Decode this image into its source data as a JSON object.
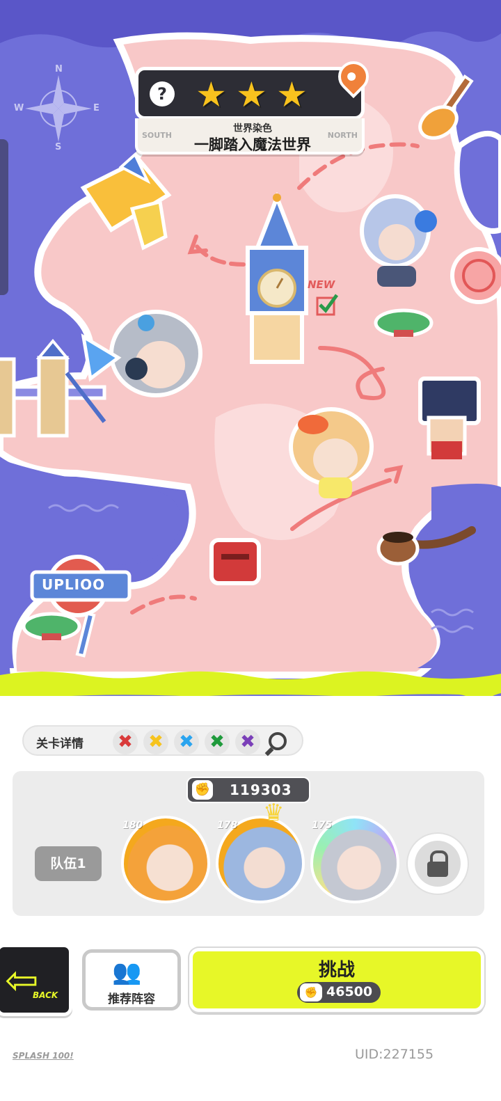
{
  "stage": {
    "stars": 3,
    "subtitle": "世界染色",
    "title": "一脚踏入魔法世界",
    "dir_left": "SOUTH",
    "dir_right": "NORTH",
    "help_label": "?"
  },
  "map": {
    "compass": {
      "n": "N",
      "s": "S",
      "e": "E",
      "w": "W"
    },
    "new_label": "NEW",
    "sign_text": "UPLIOO"
  },
  "details": {
    "label": "关卡详情",
    "color_marks": [
      {
        "color": "#d93a3a",
        "name": "red"
      },
      {
        "color": "#f6c31d",
        "name": "yellow"
      },
      {
        "color": "#2aa4ef",
        "name": "blue"
      },
      {
        "color": "#1f9a3c",
        "name": "green"
      },
      {
        "color": "#7a3fb8",
        "name": "purple"
      }
    ],
    "search_icon": "magnifier-icon"
  },
  "team": {
    "power": "119303",
    "label": "队伍1",
    "members": [
      {
        "level": "180",
        "frame_color": "#f6a41d"
      },
      {
        "level": "178",
        "frame_color": "#f6a41d",
        "leader": true
      },
      {
        "level": "175",
        "frame_color": "rainbow"
      }
    ],
    "locked_slot_icon": "lock-icon"
  },
  "actions": {
    "back_label": "BACK",
    "recommend_label": "推荐阵容",
    "challenge_label": "挑战",
    "challenge_cost": "46500"
  },
  "footer": {
    "brand": "SPLASH 100!",
    "uid": "UID:227155"
  },
  "colors": {
    "sea": "#6f6fd9",
    "land": "#f8c8c8",
    "accent": "#e7f728"
  }
}
